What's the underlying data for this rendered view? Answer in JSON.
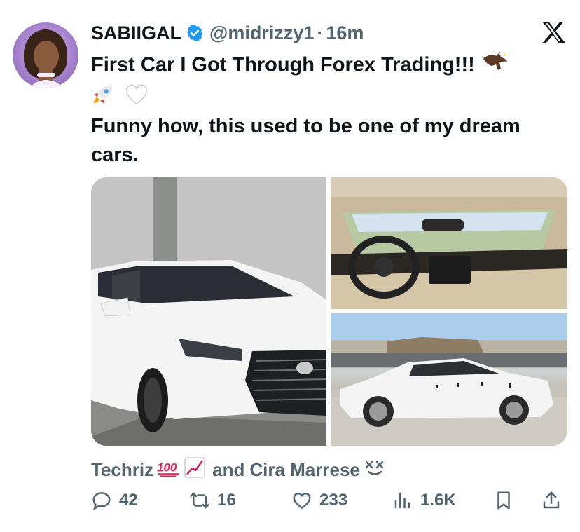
{
  "author": {
    "name": "SABIIGAL",
    "handle": "@midrizzy1",
    "separator": "·",
    "time": "16m"
  },
  "tweet": {
    "line1": "First Car I Got Through Forex Trading!!!",
    "line2": "Funny how, this used to be one of my dream cars.",
    "emojis": [
      "eagle-emoji",
      "rocket-emoji",
      "white-heart-emoji"
    ]
  },
  "liked_by": {
    "user1": "Techriz",
    "and_text": "and",
    "user2": "Cira Marrese"
  },
  "actions": {
    "replies": "42",
    "reposts": "16",
    "likes": "233",
    "views": "1.6K"
  },
  "colors": {
    "text": "#0f1419",
    "secondary": "#536471",
    "verified": "#1d9bf0",
    "hundred_red": "#e0245e"
  }
}
